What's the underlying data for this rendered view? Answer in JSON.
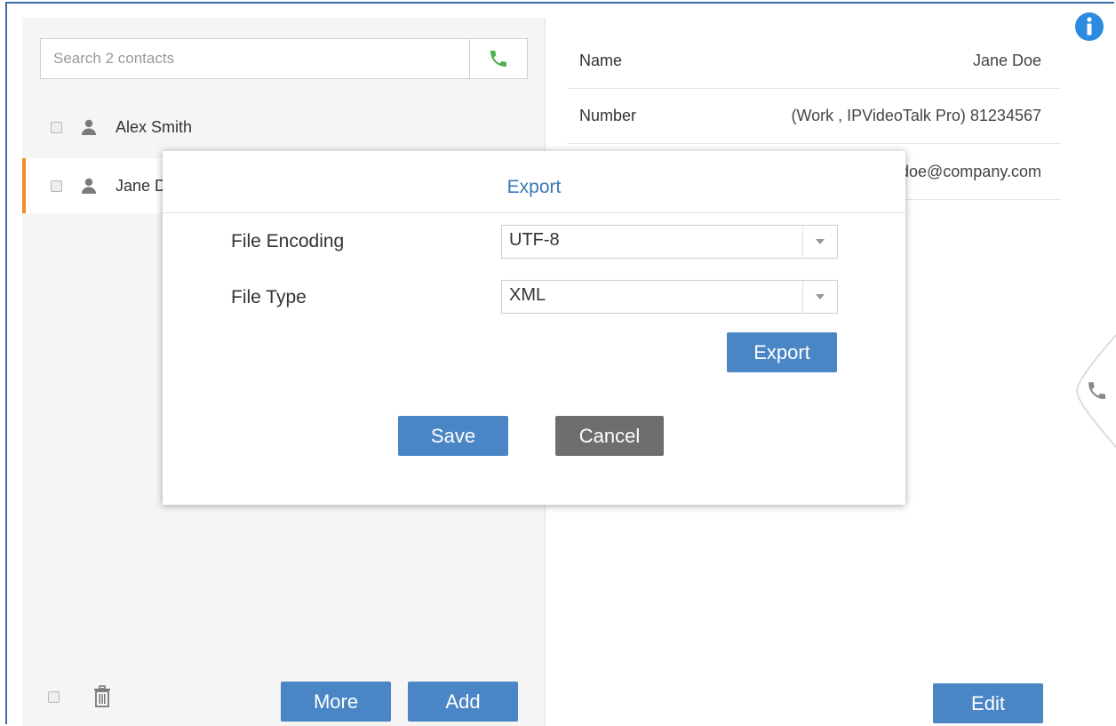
{
  "search": {
    "placeholder": "Search 2 contacts"
  },
  "contacts": [
    {
      "name": "Alex Smith"
    },
    {
      "name": "Jane Doe"
    }
  ],
  "left_footer": {
    "more_label": "More",
    "add_label": "Add"
  },
  "details": {
    "rows": [
      {
        "label": "Name",
        "value": "Jane Doe"
      },
      {
        "label": "Number",
        "value": "(Work , IPVideoTalk Pro) 81234567"
      },
      {
        "label": "",
        "value": "jane.doe@company.com"
      }
    ],
    "edit_label": "Edit"
  },
  "modal": {
    "title": "Export",
    "file_encoding": {
      "label": "File Encoding",
      "value": "UTF-8"
    },
    "file_type": {
      "label": "File Type",
      "value": "XML"
    },
    "export_label": "Export",
    "save_label": "Save",
    "cancel_label": "Cancel"
  },
  "colors": {
    "accent": "#4a86c5",
    "title": "#3a79b8",
    "selected_marker": "#f28c28",
    "cancel": "#6e6e6e",
    "call_icon": "#4caf50"
  }
}
